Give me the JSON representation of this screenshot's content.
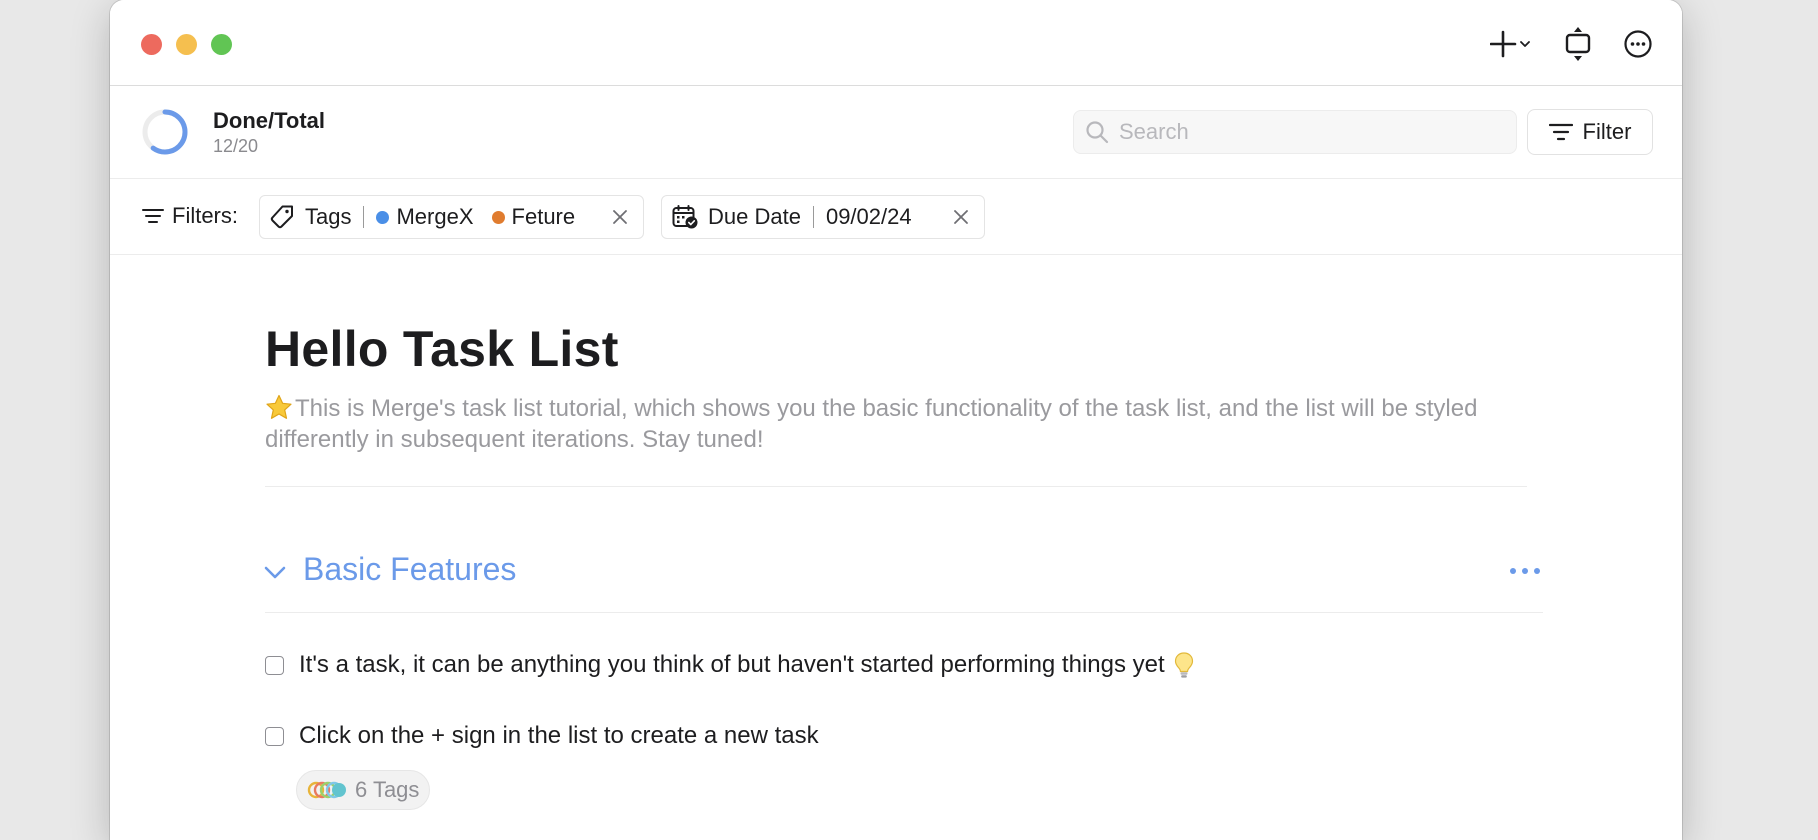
{
  "toolbar": {
    "add_icon": "plus-with-chevron-icon",
    "fit_icon": "fit-height-icon",
    "more_icon": "ellipsis-circle-icon"
  },
  "summary": {
    "title": "Done/Total",
    "count": "12/20",
    "progress": 0.6,
    "ring_color": "#6b9ae9"
  },
  "search": {
    "placeholder": "Search"
  },
  "filter_button": {
    "label": "Filter"
  },
  "filters": {
    "label": "Filters:",
    "tags_chip": {
      "field": "Tags",
      "values": [
        {
          "name": "MergeX",
          "color": "#4a8fe7"
        },
        {
          "name": "Feture",
          "color": "#e07c2f"
        }
      ]
    },
    "due_chip": {
      "field": "Due Date",
      "value": "09/02/24"
    }
  },
  "page": {
    "title": "Hello Task List",
    "description": "This is Merge's task list tutorial, which shows you the basic functionality of the task list, and the list will be styled differently in subsequent iterations. Stay tuned!"
  },
  "section": {
    "title": "Basic Features",
    "color": "#6b9ae9"
  },
  "tasks": [
    {
      "text": "It's a task, it can be anything you think of but haven't started performing things yet",
      "done": false
    },
    {
      "text": "Click on the + sign in the list to create a new task",
      "done": false,
      "tags_label": "6 Tags"
    }
  ]
}
